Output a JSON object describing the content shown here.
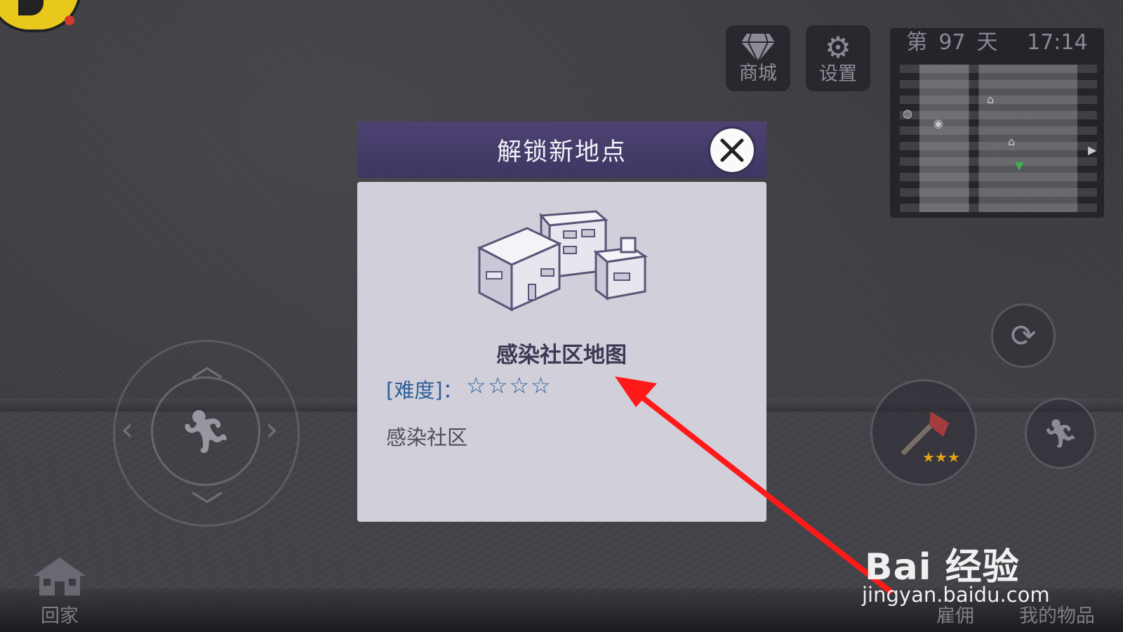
{
  "hud": {
    "shop_label": "商城",
    "settings_label": "设置"
  },
  "clock": {
    "day_prefix": "第",
    "day_number": "97",
    "day_suffix": "天",
    "time": "17:14"
  },
  "dialog": {
    "title": "解锁新地点",
    "map_name": "感染社区地图",
    "difficulty_label": "[难度]：",
    "difficulty_stars": "☆☆☆☆",
    "difficulty_value": 4,
    "description": "感染社区"
  },
  "bottom_nav": {
    "home_label": "回家",
    "hire_label": "雇佣",
    "items_label": "我的物品"
  },
  "watermark": {
    "brand": "Bai 经验",
    "url": "jingyan.baidu.com"
  },
  "colors": {
    "title_bar": "#463c6a",
    "dialog_body": "#d1d0da",
    "accent_blue": "#2f5f99",
    "annotation_arrow": "#ff1a1a"
  }
}
